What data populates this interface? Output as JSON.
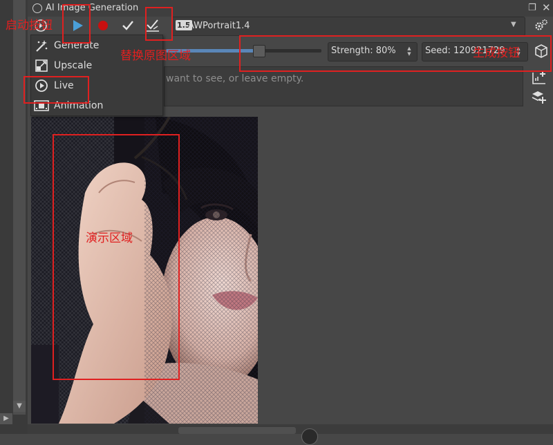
{
  "window": {
    "title": "AI Image Generation",
    "title_icon": "ai-icon",
    "float_icon": "float-window-icon",
    "close_icon": "close-icon"
  },
  "toolbar": {
    "buttons": [
      {
        "name": "mode-menu",
        "icon": "mode-icon"
      },
      {
        "name": "play",
        "icon": "play-icon",
        "color": "#4a9fd8"
      },
      {
        "name": "record",
        "icon": "record-icon",
        "color": "#c81010"
      },
      {
        "name": "apply",
        "icon": "check-icon"
      },
      {
        "name": "apply-replace",
        "icon": "check-layer-icon"
      }
    ],
    "model_badge": "1.5",
    "model_value": "AWPortrait1.4",
    "settings_icon": "gear-icon"
  },
  "strength": {
    "label": "Strength: 80%",
    "level": 0.8
  },
  "seed": {
    "label": "Seed: 1209217",
    "suffix": "29"
  },
  "prompt": {
    "text": "want to see, or leave empty."
  },
  "menu": {
    "items": [
      {
        "label": "Generate",
        "icon": "generate-icon"
      },
      {
        "label": "Upscale",
        "icon": "upscale-icon"
      },
      {
        "label": "Live",
        "icon": "live-icon"
      },
      {
        "label": "Animation",
        "icon": "animation-icon"
      }
    ]
  },
  "annotations": {
    "start": "启动按钮",
    "replace": "替换原图区域",
    "generate": "生成按钮",
    "demo": "演示区域",
    "color": "#e02020"
  },
  "colors": {
    "background": "#474747",
    "accent": "#5a86b8"
  }
}
